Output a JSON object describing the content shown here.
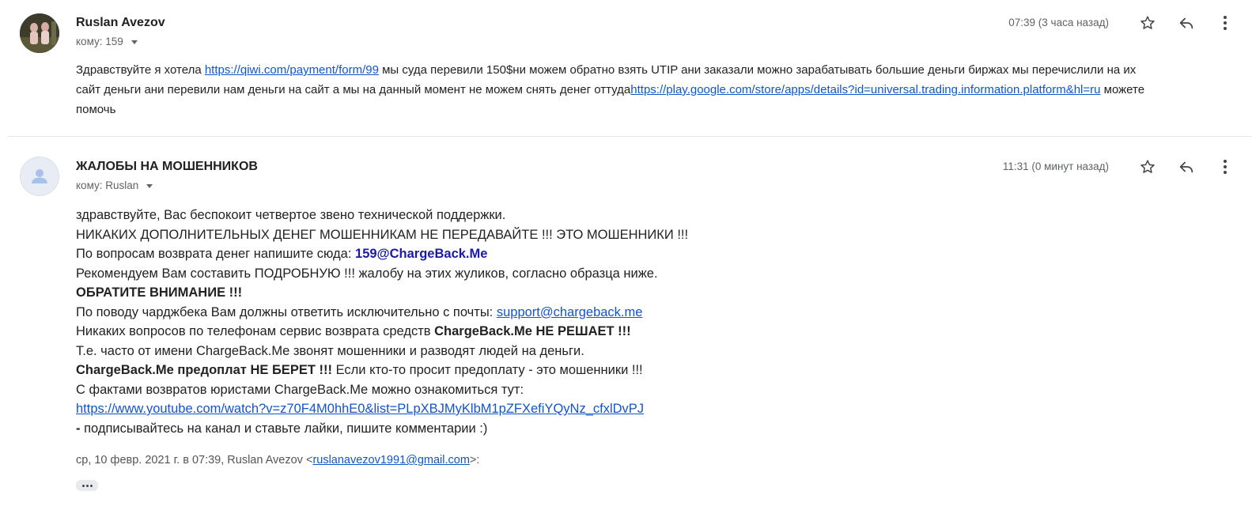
{
  "messages": [
    {
      "sender": "Ruslan Avezov",
      "recipient_label": "кому: 159",
      "time": "07:39 (3 часа назад)",
      "body": {
        "p1_pre": "Здравствуйте я хотела ",
        "p1_link": "https://qiwi.com/payment/form/99",
        "p1_post": " мы суда перевили 150$ни можем обратно взять UTIP ани заказали можно зарабатывать большие деньги  биржах  мы перечислили на их",
        "p2_pre": "сайт деньги ани перевили нам деньги на сайт а мы на данный момент не можем  снять денег оттуда",
        "p2_link": "https://play.google.com/store/apps/details?id=universal.trading.information.platform&hl=ru",
        "p2_post": " можете",
        "p3": "помочь"
      }
    },
    {
      "sender": "ЖАЛОБЫ НА МОШЕННИКОВ",
      "recipient_label": "кому: Ruslan",
      "time": "11:31 (0 минут назад)",
      "body": {
        "l1": "здравствуйте, Вас беспокоит четвертое звено технической поддержки.",
        "l2": "НИКАКИХ ДОПОЛНИТЕЛЬНЫХ ДЕНЕГ МОШЕННИКАМ НЕ ПЕРЕДАВАЙТЕ !!! ЭТО МОШЕННИКИ !!!",
        "l3_pre": "По вопросам возврата денег напишите сюда: ",
        "l3_email": "159@ChargeBack.Me",
        "l4": "Рекомендуем Вам составить ПОДРОБНУЮ !!! жалобу на этих жуликов, согласно образца ниже.",
        "l5": "ОБРАТИТЕ ВНИМАНИЕ !!!",
        "l6_pre": "По поводу чарджбека Вам должны ответить исключительно с почты: ",
        "l6_link": "support@chargeback.me",
        "l7_pre": "Никаких вопросов по телефонам сервис возврата средств ",
        "l7_bold": "ChargeBack.Me НЕ РЕШАЕТ !!!",
        "l8": "Т.е. часто от имени ChargeBack.Me звонят мошенники и разводят людей на деньги.",
        "l9_bold": "ChargeBack.Me предоплат НЕ БЕРЕТ !!!",
        "l9_post": " Если кто-то просит предоплату - это мошенники !!!",
        "l10": "С фактами возвратов юристами ChargeBack.Me можно ознакомиться тут:",
        "l11_link": "https://www.youtube.com/watch?v=z70F4M0hhE0&list=PLpXBJMyKlbM1pZFXefiYQyNz_cfxlDvPJ",
        "l12_bold": " - ",
        "l12_post": "подписывайтесь на канал и ставьте лайки, пишите комментарии :)"
      },
      "quote": {
        "pre": "ср, 10 февр. 2021 г. в 07:39, Ruslan Avezov <",
        "email": "ruslanavezov1991@gmail.com",
        "post": ">:"
      }
    }
  ],
  "icons": {
    "star": "star-icon",
    "reply": "reply-icon",
    "more": "more-vert-icon",
    "avatar_default": "person-icon"
  },
  "colors": {
    "link": "#1155cc",
    "brand_email": "#1a1aa6",
    "meta_text": "#5f6368"
  }
}
